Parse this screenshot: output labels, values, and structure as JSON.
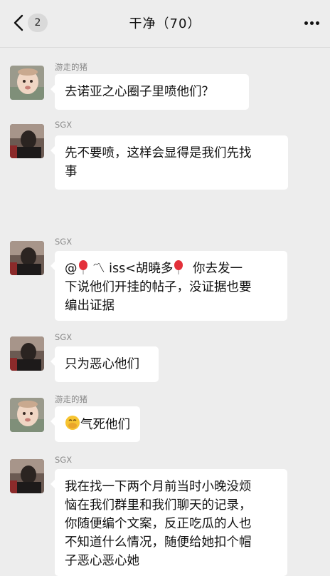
{
  "header": {
    "back_icon": "chevron-left-icon",
    "unread_count": "2",
    "title": "干净（70）",
    "more_icon": "more-dots-icon"
  },
  "messages": [
    {
      "sender": "游走的猪",
      "avatar": "baby-avatar",
      "lines": [
        "去诺亚之心圈子里喷他们？"
      ]
    },
    {
      "sender": "SGX",
      "avatar": "dark-avatar",
      "lines": [
        "先不要喷，这样会显得是我们先找",
        "事"
      ]
    },
    {
      "sender": "SGX",
      "avatar": "dark-avatar",
      "mention_prefix": "@",
      "mention_name": "〽 iss<胡曉多",
      "lines_after_first": "你去发一",
      "lines": [
        "下说他们开挂的帖子，没证据也要",
        "编出证据"
      ]
    },
    {
      "sender": "SGX",
      "avatar": "dark-avatar",
      "lines": [
        "只为恶心他们"
      ]
    },
    {
      "sender": "游走的猪",
      "avatar": "baby-avatar",
      "emoji": "face-hand-over-mouth-emoji",
      "lines": [
        "气死他们"
      ]
    },
    {
      "sender": "SGX",
      "avatar": "dark-avatar",
      "lines": [
        "我在找一下两个月前当时小晚没烦",
        "恼在我们群里和我们聊天的记录，",
        "你随便编个文案，反正吃瓜的人也",
        "不知道什么情况，随便给她扣个帽",
        "子恶心恶心她"
      ]
    }
  ]
}
